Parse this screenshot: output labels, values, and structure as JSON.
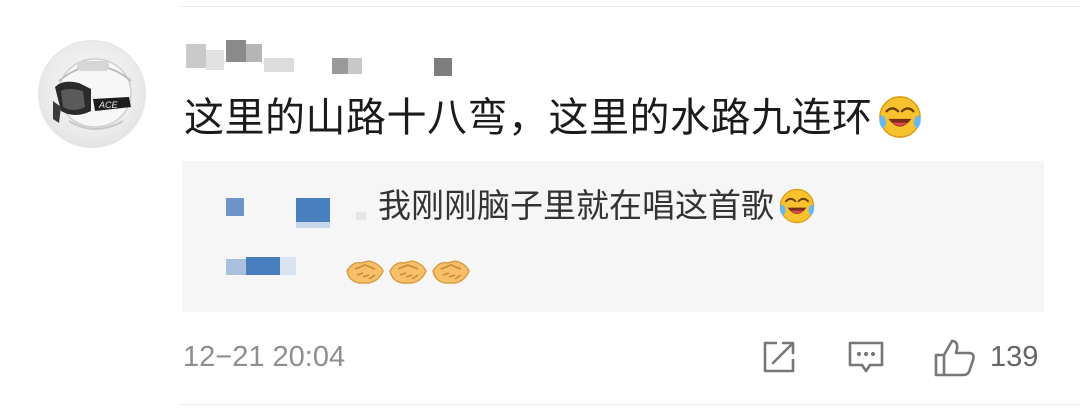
{
  "comment": {
    "username": "",
    "text": "这里的山路十八弯，这里的水路九连环",
    "emoji": "laughing-crying-face"
  },
  "reply": {
    "text": "我刚刚脑子里就在唱这首歌",
    "emoji": "laughing-crying-face",
    "second_emojis": [
      "handshake-emoji",
      "handshake-emoji",
      "handshake-emoji"
    ]
  },
  "footer": {
    "timestamp": "12−21 20:04",
    "like_count": "139",
    "icons": [
      "share-icon",
      "comment-icon",
      "like-icon"
    ]
  },
  "colors": {
    "reply_background": "#f6f6f6",
    "secondary_text": "#8e8e8e",
    "blur_blue": "#4a7fbf"
  }
}
